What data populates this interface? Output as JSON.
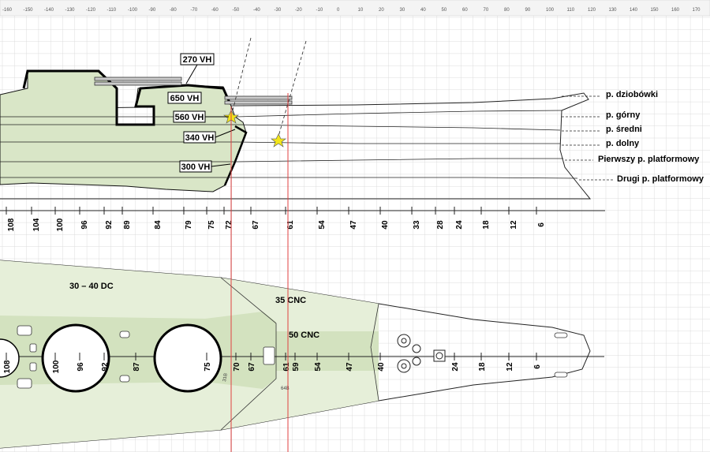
{
  "ruler": [
    "-160",
    "-150",
    "-140",
    "-130",
    "-120",
    "-110",
    "-100",
    "-90",
    "-80",
    "-70",
    "-60",
    "-50",
    "-40",
    "-30",
    "-20",
    "-10",
    "0",
    "10",
    "20",
    "30",
    "40",
    "50",
    "60",
    "70",
    "80",
    "90",
    "100",
    "110",
    "120",
    "130",
    "140",
    "150",
    "160",
    "170"
  ],
  "armor_labels": [
    "270 VH",
    "650 VH",
    "560 VH",
    "340 VH",
    "300 VH"
  ],
  "deck_labels": [
    "p. dziobówki",
    "p. górny",
    "p. średni",
    "p. dolny",
    "Pierwszy p. platformowy",
    "Drugi p. platformowy"
  ],
  "profile_frames": [
    "108",
    "104",
    "100",
    "96",
    "92",
    "89",
    "84",
    "79",
    "75",
    "72",
    "67",
    "61",
    "54",
    "47",
    "40",
    "33",
    "28",
    "24",
    "18",
    "12",
    "6"
  ],
  "plan_frames": [
    "108",
    "100",
    "96",
    "92",
    "87",
    "75",
    "70",
    "67",
    "61",
    "59",
    "54",
    "47",
    "40",
    "24",
    "18",
    "12",
    "6"
  ],
  "plan_labels": [
    "30 – 40 DC",
    "35 CNC",
    "50 CNC"
  ],
  "small_marks": [
    "31B",
    "64B"
  ],
  "colors": {
    "armor_fill": "#d9e6c7",
    "plan_fill": "#e6efd9",
    "section_line": "#e04040",
    "grid": "#dcdcdc"
  }
}
